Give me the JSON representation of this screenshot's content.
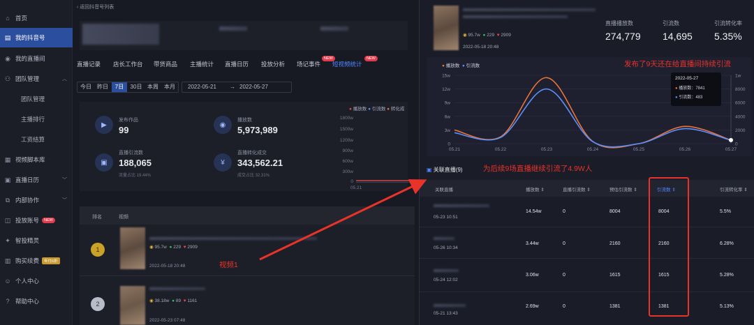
{
  "sidebar": {
    "items": [
      {
        "label": "首页",
        "icon": "home-icon"
      },
      {
        "label": "我的抖音号",
        "icon": "account-icon",
        "active": true
      },
      {
        "label": "我的直播间",
        "icon": "live-room-icon"
      },
      {
        "label": "团队管理",
        "icon": "team-icon",
        "expanded": true
      },
      {
        "label": "团队管理",
        "sub": true
      },
      {
        "label": "主播排行",
        "sub": true
      },
      {
        "label": "工资结算",
        "sub": true
      },
      {
        "label": "视频脚本库",
        "icon": "script-icon"
      },
      {
        "label": "直播日历",
        "icon": "calendar-icon"
      },
      {
        "label": "内部协作",
        "icon": "collab-icon"
      },
      {
        "label": "投放账号",
        "icon": "ad-account-icon",
        "badge": "NEW"
      },
      {
        "label": "智投精灵",
        "icon": "wizard-icon"
      },
      {
        "label": "购买续费",
        "icon": "cart-icon",
        "badge": "年付6折"
      },
      {
        "label": "个人中心",
        "icon": "user-icon"
      },
      {
        "label": "帮助中心",
        "icon": "help-icon"
      }
    ]
  },
  "left": {
    "back_link": "返回抖音号列表",
    "tabs": [
      "直播记录",
      "店长工作台",
      "带货商品",
      "主播统计",
      "直播日历",
      "投放分析",
      "场记事件",
      "短视频统计"
    ],
    "tab_badge": "NEW",
    "date_buttons": [
      "今日",
      "昨日",
      "7日",
      "30日",
      "本周",
      "本月"
    ],
    "date_start": "2022-05-21",
    "date_sep": "→",
    "date_end": "2022-05-27",
    "stats": [
      {
        "label": "发布作品",
        "value": "99",
        "sub": ""
      },
      {
        "label": "播放数",
        "value": "5,973,989",
        "sub": ""
      },
      {
        "label": "直播引流数",
        "value": "188,065",
        "sub": "流量占比 19.44%"
      },
      {
        "label": "直播转化成交",
        "value": "343,562.21",
        "sub": "成交占比 32.31%"
      }
    ],
    "chart_legend": [
      "播放数",
      "引流数",
      "转化成"
    ],
    "chart_yticks": [
      "1800w",
      "1500w",
      "1200w",
      "900w",
      "600w",
      "300w",
      "0"
    ],
    "chart_xtick": "05.21",
    "list_headers": [
      "排名",
      "视频"
    ],
    "videos": [
      {
        "plays": "95.7w",
        "likes": "229",
        "hearts": "2909",
        "date": "2022-05-18 20:48"
      },
      {
        "plays": "38.18w",
        "likes": "89",
        "hearts": "1161",
        "date": "2022-05-23 07:48"
      }
    ]
  },
  "right": {
    "video": {
      "plays": "95.7w",
      "likes": "229",
      "hearts": "2909",
      "date": "2022-05-18 20:48"
    },
    "kpis": [
      {
        "label": "直播播放数",
        "value": "274,779"
      },
      {
        "label": "引流数",
        "value": "14,695"
      },
      {
        "label": "引流转化率",
        "value": "5.35%"
      }
    ],
    "chart_legend": [
      "播放数",
      "引流数"
    ],
    "related_title": "关联直播(9)",
    "table_headers": [
      "关联直播",
      "播放数",
      "直播引流数",
      "预估引流数",
      "引流数",
      "引流转化率"
    ],
    "rows": [
      {
        "time": "05-23 10:51",
        "plays": "14.54w",
        "live_traffic": "0",
        "est": "8004",
        "traffic": "8004",
        "rate": "5.5%"
      },
      {
        "time": "05-26 10:34",
        "plays": "3.44w",
        "live_traffic": "0",
        "est": "2160",
        "traffic": "2160",
        "rate": "6.28%"
      },
      {
        "time": "05-24 12:02",
        "plays": "3.06w",
        "live_traffic": "0",
        "est": "1615",
        "traffic": "1615",
        "rate": "5.28%"
      },
      {
        "time": "05-21 13:43",
        "plays": "2.69w",
        "live_traffic": "0",
        "est": "1381",
        "traffic": "1381",
        "rate": "5.13%"
      }
    ]
  },
  "chart_data": {
    "type": "line",
    "x": [
      "05.21",
      "05.22",
      "05.23",
      "05.24",
      "05.25",
      "05.26",
      "05.27"
    ],
    "series": [
      {
        "name": "播放数",
        "values": [
          30000,
          15000,
          145000,
          5000,
          0,
          38000,
          7841
        ],
        "color": "#e8743b"
      },
      {
        "name": "引流数",
        "values": [
          1600,
          900,
          8000,
          300,
          0,
          2200,
          483
        ],
        "color": "#5b8ff9"
      }
    ],
    "yleft_ticks": [
      "15w",
      "12w",
      "9w",
      "6w",
      "3w",
      "0"
    ],
    "yright_ticks": [
      "1w",
      "8000",
      "6000",
      "4000",
      "2000",
      "0"
    ],
    "ylim_left": [
      0,
      150000
    ],
    "ylim_right": [
      0,
      10000
    ],
    "tooltip": {
      "date": "2022-05-27",
      "rows": [
        {
          "label": "播放数",
          "value": "7841"
        },
        {
          "label": "引流数",
          "value": "483"
        }
      ]
    }
  },
  "annotations": {
    "top": "发布了9天还在给直播间持续引流",
    "middle": "为后续9场直播继续引流了4.9W人",
    "video_label": "视频1"
  },
  "colors": {
    "accent": "#2b4f9e",
    "annotation": "#e8332a",
    "orange": "#e8743b",
    "blue": "#5b8ff9"
  }
}
